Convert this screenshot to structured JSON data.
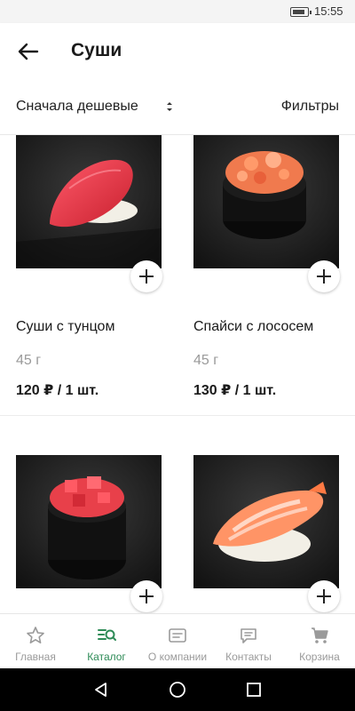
{
  "status_bar": {
    "time": "15:55"
  },
  "header": {
    "title": "Суши"
  },
  "sort": {
    "label": "Сначала дешевые",
    "filters_label": "Фильтры"
  },
  "products": [
    {
      "name": "Суши с тунцом",
      "weight": "45 г",
      "price": "120 ₽ / 1 шт."
    },
    {
      "name": "Спайси с лососем",
      "weight": "45 г",
      "price": "130 ₽ / 1 шт."
    },
    {
      "name": "",
      "weight": "",
      "price": ""
    },
    {
      "name": "",
      "weight": "",
      "price": ""
    }
  ],
  "bottom_nav": {
    "items": [
      {
        "label": "Главная",
        "icon": "star-icon"
      },
      {
        "label": "Каталог",
        "icon": "catalog-search-icon"
      },
      {
        "label": "О компании",
        "icon": "info-card-icon"
      },
      {
        "label": "Контакты",
        "icon": "chat-icon"
      },
      {
        "label": "Корзина",
        "icon": "cart-icon"
      }
    ],
    "active_index": 1
  },
  "colors": {
    "accent": "#2e8b57",
    "inactive": "#9a9a9a",
    "text": "#1a1a1a"
  }
}
